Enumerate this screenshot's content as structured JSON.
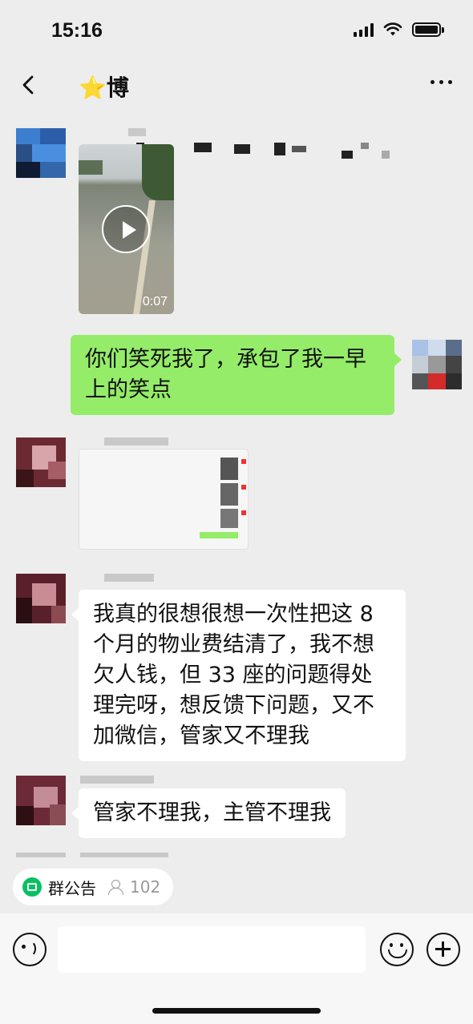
{
  "status_bar": {
    "time": "15:16"
  },
  "nav": {
    "title_prefix": "⭐博",
    "back_icon": "chevron-left-icon",
    "more_icon": "more-dots-icon"
  },
  "messages": [
    {
      "id": "m1",
      "side": "left",
      "type": "video",
      "duration": "0:07"
    },
    {
      "id": "m2",
      "side": "right",
      "type": "text",
      "text": "你们笑死我了，承包了我一早上的笑点"
    },
    {
      "id": "m3",
      "side": "left",
      "type": "image"
    },
    {
      "id": "m4",
      "side": "left",
      "type": "text",
      "text": "我真的很想很想一次性把这 8 个月的物业费结清了，我不想欠人钱，但 33 座的问题得处理完呀，想反馈下问题，又不加微信，管家又不理我"
    },
    {
      "id": "m5",
      "side": "left",
      "type": "text",
      "text": "管家不理我，主管不理我"
    }
  ],
  "announcement": {
    "label": "群公告",
    "member_count": "102"
  },
  "input": {
    "placeholder": ""
  },
  "colors": {
    "background": "#ededed",
    "sent_bubble": "#95ec69",
    "received_bubble": "#ffffff",
    "accent_green": "#07c160"
  }
}
